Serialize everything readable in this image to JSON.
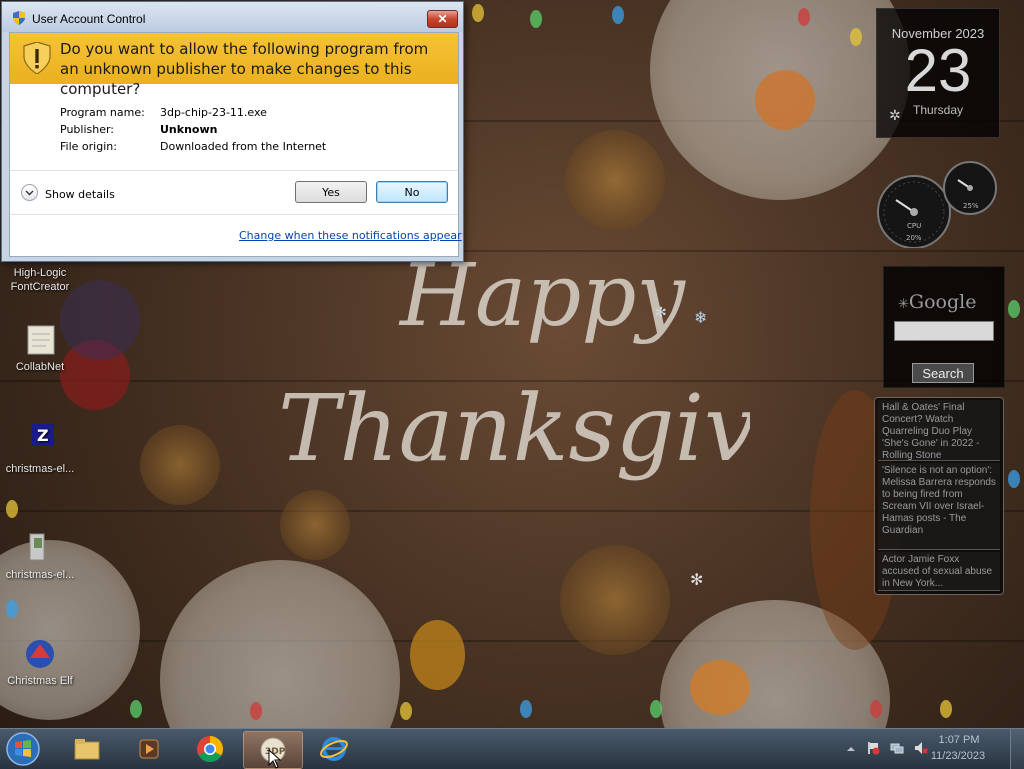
{
  "desktop": {
    "wallpaper_title_line1": "Happy",
    "wallpaper_title_line2": "Thanksgiving",
    "icons": [
      {
        "label": "FontCreator",
        "label_top": "High-Logic",
        "icon": "fontcreator-icon"
      },
      {
        "label": "CollabNet",
        "icon": "collabnet-icon"
      },
      {
        "label": "christmas-el...",
        "icon": "zip-archive-icon"
      },
      {
        "label": "christmas-el...",
        "icon": "installer-icon"
      },
      {
        "label": "Christmas Elf",
        "icon": "christmas-elf-icon"
      }
    ]
  },
  "gadgets": {
    "calendar": {
      "month_year": "November 2023",
      "day": "23",
      "weekday": "Thursday"
    },
    "cpu_meter": {
      "cpu_label": "CPU",
      "cpu_percent": "20%",
      "ram_percent": "25%"
    },
    "google": {
      "logo": "Google",
      "search_button": "Search",
      "search_value": ""
    },
    "news": {
      "items": [
        "Hall & Oates' Final Concert? Watch Quarreling Duo Play 'She's Gone' in 2022 - Rolling Stone",
        "'Silence is not an option': Melissa Barrera responds to being fired from Scream VII over Israel-Hamas posts - The Guardian",
        "Actor Jamie Foxx accused of sexual abuse in New York..."
      ]
    }
  },
  "uac_dialog": {
    "title": "User Account Control",
    "close_label": "✕",
    "question": "Do you want to allow the following program from an unknown publisher to make changes to this computer?",
    "fields": {
      "program_name_label": "Program name:",
      "program_name_value": "3dp-chip-23-11.exe",
      "publisher_label": "Publisher:",
      "publisher_value": "Unknown",
      "file_origin_label": "File origin:",
      "file_origin_value": "Downloaded from the Internet"
    },
    "show_details_label": "Show details",
    "yes_label": "Yes",
    "no_label": "No",
    "notification_link": "Change when these notifications appear",
    "banner_color": "#f0bd2e"
  },
  "taskbar": {
    "items": [
      {
        "name": "start-button",
        "icon": "windows-logo-icon"
      },
      {
        "name": "windows-explorer",
        "icon": "folder-icon"
      },
      {
        "name": "media-player",
        "icon": "media-player-icon"
      },
      {
        "name": "google-chrome",
        "icon": "chrome-icon"
      },
      {
        "name": "3dp-chip",
        "icon": "3dp-chip-icon",
        "active": true
      },
      {
        "name": "internet-explorer",
        "icon": "internet-explorer-icon"
      }
    ],
    "clock_time": "1:07 PM",
    "clock_date": "11/23/2023"
  }
}
